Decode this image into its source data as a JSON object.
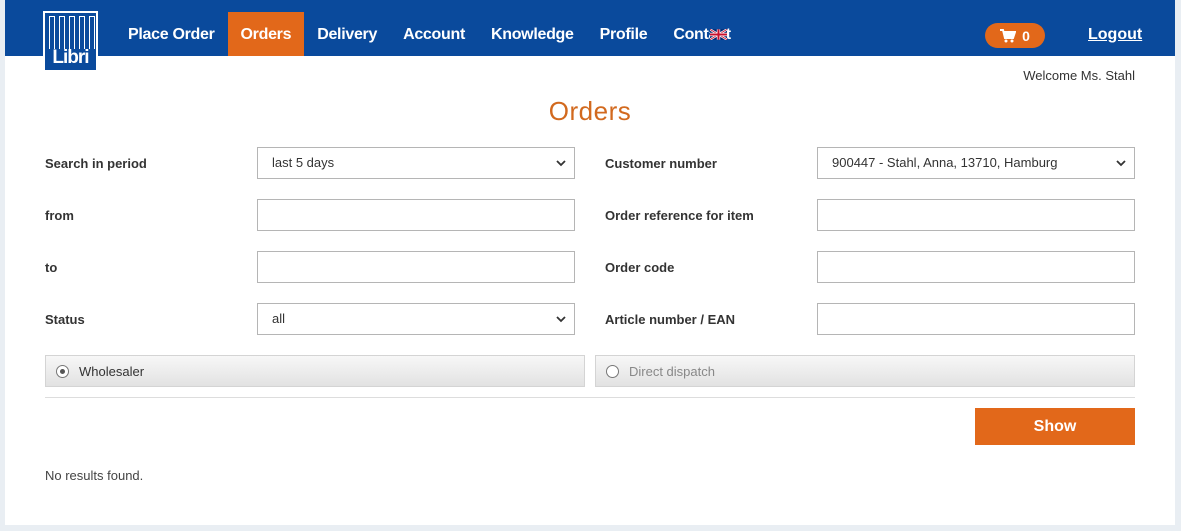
{
  "header": {
    "logo_text": "Libri",
    "nav": [
      {
        "label": "Place Order",
        "active": false
      },
      {
        "label": "Orders",
        "active": true
      },
      {
        "label": "Delivery",
        "active": false
      },
      {
        "label": "Account",
        "active": false
      },
      {
        "label": "Knowledge",
        "active": false
      },
      {
        "label": "Profile",
        "active": false
      },
      {
        "label": "Contact",
        "active": false
      }
    ],
    "language_icon": "uk-flag-icon",
    "cart_count": "0",
    "logout_label": "Logout"
  },
  "welcome_text": "Welcome Ms. Stahl",
  "page_title": "Orders",
  "form": {
    "search_period": {
      "label": "Search in period",
      "value": "last 5 days"
    },
    "from": {
      "label": "from",
      "value": ""
    },
    "to": {
      "label": "to",
      "value": ""
    },
    "status": {
      "label": "Status",
      "value": "all"
    },
    "customer_number": {
      "label": "Customer number",
      "value": "900447 - Stahl, Anna, 13710, Hamburg"
    },
    "order_reference": {
      "label": "Order reference for item",
      "value": ""
    },
    "order_code": {
      "label": "Order code",
      "value": ""
    },
    "article_number": {
      "label": "Article number / EAN",
      "value": ""
    },
    "radio_wholesaler": {
      "label": "Wholesaler",
      "checked": true
    },
    "radio_direct": {
      "label": "Direct dispatch",
      "checked": false
    }
  },
  "show_label": "Show",
  "results_text": "No results found.",
  "colors": {
    "brand_blue": "#0a4a9c",
    "accent_orange": "#e2681a",
    "title_orange": "#d2691e"
  }
}
